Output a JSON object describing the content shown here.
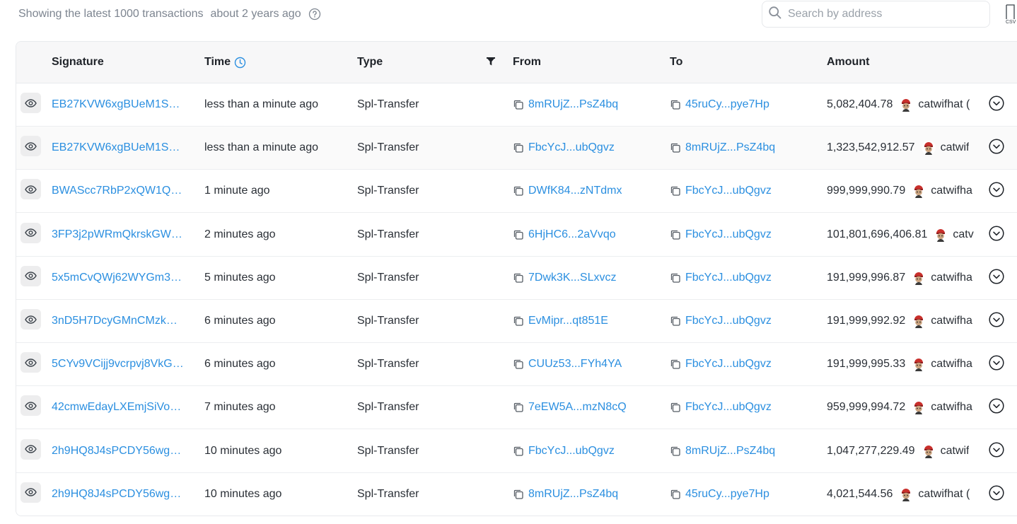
{
  "header": {
    "info_text": "Showing the latest 1000 transactions",
    "updated": "about 2 years ago",
    "search_placeholder": "Search by address"
  },
  "columns": {
    "signature": "Signature",
    "time": "Time",
    "type": "Type",
    "from": "From",
    "to": "To",
    "amount": "Amount"
  },
  "colors": {
    "link": "#2b8fe0",
    "header_bg": "#f7f7f8"
  },
  "icons": {
    "search": "search-icon",
    "help": "help-circle-icon",
    "csv": "csv-export-icon",
    "clock": "clock-icon",
    "filter": "filter-icon",
    "eye": "eye-icon",
    "copy": "copy-icon",
    "expand": "chevron-down-circle-icon",
    "token": "catwifhat-token-icon"
  },
  "rows": [
    {
      "signature": "EB27KVW6xgBUeM1So…",
      "time": "less than a minute ago",
      "type": "Spl-Transfer",
      "from": "8mRUjZ...PsZ4bq",
      "to": "45ruCy...pye7Hp",
      "amount": "5,082,404.78",
      "token": "catwifhat ("
    },
    {
      "signature": "EB27KVW6xgBUeM1So…",
      "time": "less than a minute ago",
      "type": "Spl-Transfer",
      "from": "FbcYcJ...ubQgvz",
      "to": "8mRUjZ...PsZ4bq",
      "amount": "1,323,542,912.57",
      "token": "catwif"
    },
    {
      "signature": "BWAScc7RbP2xQW1Q…",
      "time": "1 minute ago",
      "type": "Spl-Transfer",
      "from": "DWfK84...zNTdmx",
      "to": "FbcYcJ...ubQgvz",
      "amount": "999,999,990.79",
      "token": "catwifha"
    },
    {
      "signature": "3FP3j2pWRmQkrskGW…",
      "time": "2 minutes ago",
      "type": "Spl-Transfer",
      "from": "6HjHC6...2aVvqo",
      "to": "FbcYcJ...ubQgvz",
      "amount": "101,801,696,406.81",
      "token": "catv"
    },
    {
      "signature": "5x5mCvQWj62WYGm3…",
      "time": "5 minutes ago",
      "type": "Spl-Transfer",
      "from": "7Dwk3K...SLxvcz",
      "to": "FbcYcJ...ubQgvz",
      "amount": "191,999,996.87",
      "token": "catwifha"
    },
    {
      "signature": "3nD5H7DcyGMnCMzk…",
      "time": "6 minutes ago",
      "type": "Spl-Transfer",
      "from": "EvMipr...qt851E",
      "to": "FbcYcJ...ubQgvz",
      "amount": "191,999,992.92",
      "token": "catwifha"
    },
    {
      "signature": "5CYv9VCijj9vcrpvj8VkG…",
      "time": "6 minutes ago",
      "type": "Spl-Transfer",
      "from": "CUUz53...FYh4YA",
      "to": "FbcYcJ...ubQgvz",
      "amount": "191,999,995.33",
      "token": "catwifha"
    },
    {
      "signature": "42cmwEdayLXEmjSiVo…",
      "time": "7 minutes ago",
      "type": "Spl-Transfer",
      "from": "7eEW5A...mzN8cQ",
      "to": "FbcYcJ...ubQgvz",
      "amount": "959,999,994.72",
      "token": "catwifha"
    },
    {
      "signature": "2h9HQ8J4sPCDY56wg…",
      "time": "10 minutes ago",
      "type": "Spl-Transfer",
      "from": "FbcYcJ...ubQgvz",
      "to": "8mRUjZ...PsZ4bq",
      "amount": "1,047,277,229.49",
      "token": "catwif"
    },
    {
      "signature": "2h9HQ8J4sPCDY56wg…",
      "time": "10 minutes ago",
      "type": "Spl-Transfer",
      "from": "8mRUjZ...PsZ4bq",
      "to": "45ruCy...pye7Hp",
      "amount": "4,021,544.56",
      "token": "catwifhat ("
    }
  ]
}
